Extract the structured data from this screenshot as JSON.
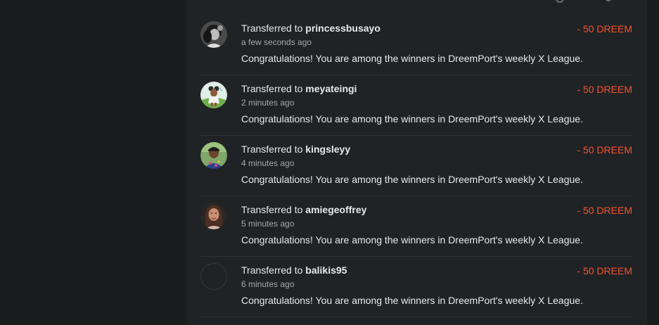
{
  "transactions": [
    {
      "prefix": "Transferred to ",
      "user": "princessbusayo",
      "time": "a few seconds ago",
      "message": "Congratulations! You are among the winners in DreemPort's weekly X League.",
      "amount": "- 50 DREEM",
      "avatar": "avatar-photo-grayscale"
    },
    {
      "prefix": "Transferred to ",
      "user": "meyateingi",
      "time": "2 minutes ago",
      "message": "Congratulations! You are among the winners in DreemPort's weekly X League.",
      "amount": "- 50 DREEM",
      "avatar": "avatar-illustration"
    },
    {
      "prefix": "Transferred to ",
      "user": "kingsleyy",
      "time": "4 minutes ago",
      "message": "Congratulations! You are among the winners in DreemPort's weekly X League.",
      "amount": "- 50 DREEM",
      "avatar": "avatar-photo"
    },
    {
      "prefix": "Transferred to ",
      "user": "amiegeoffrey",
      "time": "5 minutes ago",
      "message": "Congratulations! You are among the winners in DreemPort's weekly X League.",
      "amount": "- 50 DREEM",
      "avatar": "avatar-photo"
    },
    {
      "prefix": "Transferred to ",
      "user": "balikis95",
      "time": "6 minutes ago",
      "message": "Congratulations! You are among the winners in DreemPort's weekly X League.",
      "amount": "- 50 DREEM",
      "avatar": "avatar-empty"
    }
  ],
  "colors": {
    "background": "#1a1c1e",
    "panel": "#202326",
    "amount": "#f0532f",
    "text": "#e8e8e8",
    "muted": "#a3a7ab"
  }
}
